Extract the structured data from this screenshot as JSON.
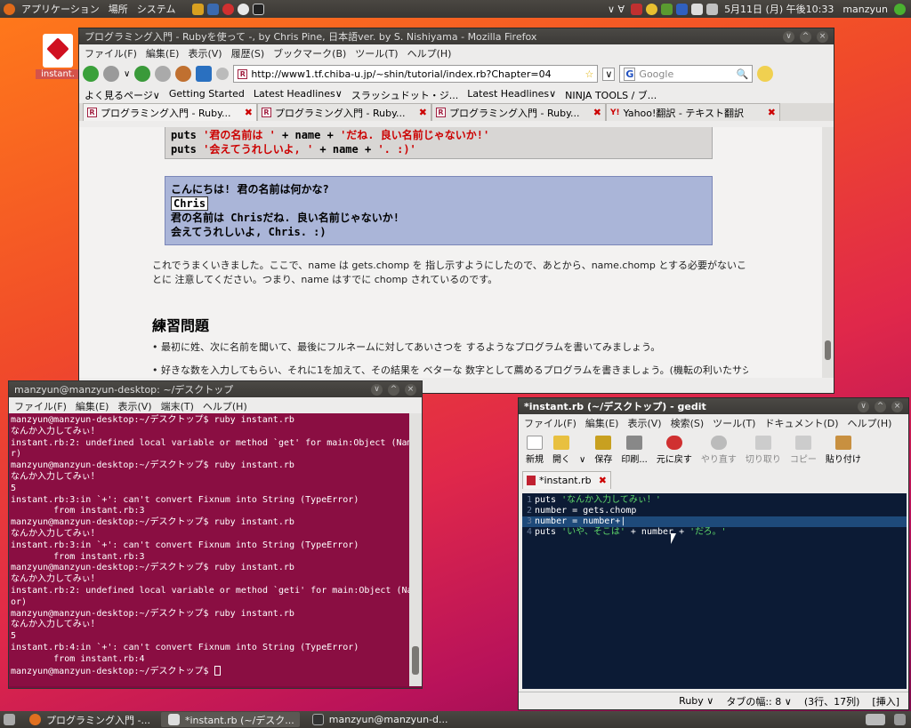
{
  "top_panel": {
    "menus": [
      "アプリケーション",
      "場所",
      "システム"
    ],
    "datetime": "5月11日 (月) 午後10:33",
    "user": "manzyun"
  },
  "desktop_icon": {
    "label": "instant."
  },
  "firefox": {
    "title": "プログラミング入門 - Rubyを使って -, by Chris Pine, 日本語ver. by S. Nishiyama - Mozilla Firefox",
    "menu": [
      "ファイル(F)",
      "編集(E)",
      "表示(V)",
      "履歴(S)",
      "ブックマーク(B)",
      "ツール(T)",
      "ヘルプ(H)"
    ],
    "url": "http://www1.tf.chiba-u.jp/~shin/tutorial/index.rb?Chapter=04",
    "search_placeholder": "Google",
    "bookmarks": [
      "よく見るページ∨",
      "Getting Started",
      "Latest Headlines∨",
      "スラッシュドット・ジ...",
      "Latest Headlines∨",
      "NINJA TOOLS / ブ..."
    ],
    "tabs": [
      {
        "label": "プログラミング入門 - Ruby..."
      },
      {
        "label": "プログラミング入門 - Ruby..."
      },
      {
        "label": "プログラミング入門 - Ruby..."
      },
      {
        "label": "Yahoo!翻訳 - テキスト翻訳"
      }
    ],
    "content": {
      "code_line1_a": "puts ",
      "code_line1_b": "'君の名前は '",
      "code_line1_c": " + name + ",
      "code_line1_d": "'だね. 良い名前じゃないか!'",
      "code_line2_a": "puts ",
      "code_line2_b": "'会えてうれしいよ, '",
      "code_line2_c": " + name + ",
      "code_line2_d": "'.   :)'",
      "out1": "こんにちは! 君の名前は何かな?",
      "out_input": "Chris",
      "out3": "君の名前は Chrisだね. 良い名前じゃないか!",
      "out4": "会えてうれしいよ, Chris.  :)",
      "para": "これでうまくいきました。ここで、name は gets.chomp を 指し示すようにしたので、あとから、name.chomp とする必要がないことに 注意してください。つまり、name はすでに chomp されているのです。",
      "heading": "練習問題",
      "bullet1": "• 最初に姓、次に名前を聞いて、最後にフルネームに対してあいさつを するようなプログラムを書いてみましょう。",
      "bullet2": "• 好きな数を入力してもらい、それに1を加えて、その結果を ベターな 数字として薦めるプログラムを書きましょう。(機転の利いたサジェスチョン"
    }
  },
  "terminal": {
    "title": "manzyun@manzyun-desktop: ~/デスクトップ",
    "menu": [
      "ファイル(F)",
      "編集(E)",
      "表示(V)",
      "端末(T)",
      "ヘルプ(H)"
    ],
    "lines": [
      "manzyun@manzyun-desktop:~/デスクトップ$ ruby instant.rb",
      "なんか入力してみぃ！",
      "instant.rb:2: undefined local variable or method `get' for main:Object (NameErro",
      "r)",
      "manzyun@manzyun-desktop:~/デスクトップ$ ruby instant.rb",
      "なんか入力してみぃ！",
      "5",
      "instant.rb:3:in `+': can't convert Fixnum into String (TypeError)",
      "        from instant.rb:3",
      "manzyun@manzyun-desktop:~/デスクトップ$ ruby instant.rb",
      "なんか入力してみぃ！",
      "",
      "instant.rb:3:in `+': can't convert Fixnum into String (TypeError)",
      "        from instant.rb:3",
      "manzyun@manzyun-desktop:~/デスクトップ$ ruby instant.rb",
      "なんか入力してみぃ！",
      "instant.rb:2: undefined local variable or method `geti' for main:Object (NameErr",
      "or)",
      "manzyun@manzyun-desktop:~/デスクトップ$ ruby instant.rb",
      "なんか入力してみぃ！",
      "5",
      "instant.rb:4:in `+': can't convert Fixnum into String (TypeError)",
      "        from instant.rb:4"
    ],
    "prompt": "manzyun@manzyun-desktop:~/デスクトップ$ "
  },
  "gedit": {
    "title": "*instant.rb (~/デスクトップ) - gedit",
    "menu": [
      "ファイル(F)",
      "編集(E)",
      "表示(V)",
      "検索(S)",
      "ツール(T)",
      "ドキュメント(D)",
      "ヘルプ(H)"
    ],
    "toolbar": [
      "新規",
      "開く",
      "保存",
      "印刷...",
      "元に戻す",
      "やり直す",
      "切り取り",
      "コピー",
      "貼り付け"
    ],
    "tab": "*instant.rb",
    "code": [
      {
        "n": "1",
        "parts": [
          {
            "t": "puts ",
            "c": "s-ident"
          },
          {
            "t": "'なんか入力してみぃ！'",
            "c": "s-str"
          }
        ]
      },
      {
        "n": "2",
        "parts": [
          {
            "t": "number = gets.chomp",
            "c": "s-ident"
          }
        ]
      },
      {
        "n": "3",
        "parts": [
          {
            "t": "number = number+|",
            "c": "s-ident"
          }
        ]
      },
      {
        "n": "4",
        "parts": [
          {
            "t": "puts ",
            "c": "s-ident"
          },
          {
            "t": "'いや、そこは'",
            "c": "s-str"
          },
          {
            "t": " + number + ",
            "c": "s-ident"
          },
          {
            "t": "'だろ。'",
            "c": "s-str"
          }
        ]
      }
    ],
    "status": [
      "Ruby ∨",
      "タブの幅:: 8 ∨",
      "(3行、17列)",
      "[挿入]"
    ]
  },
  "taskbar": {
    "items": [
      "プログラミング入門 -...",
      "*instant.rb (~/デスク...",
      "manzyun@manzyun-d..."
    ]
  }
}
